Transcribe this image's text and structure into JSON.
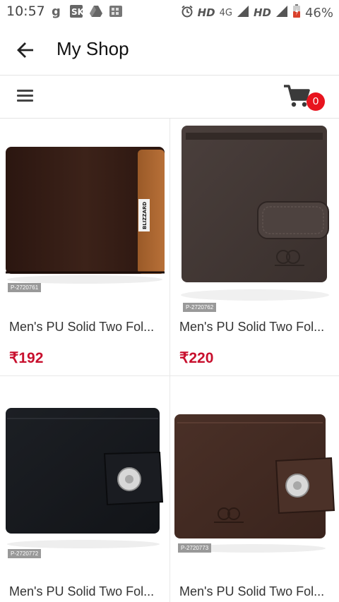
{
  "status": {
    "time": "10:57",
    "net_hd1": "HD",
    "net_4g": "4G",
    "net_hd2": "HD",
    "battery": "46%"
  },
  "header": {
    "title": "My Shop"
  },
  "cart": {
    "count": "0"
  },
  "products": [
    {
      "id": "P-2720761",
      "name": "Men's PU Solid Two Fol...",
      "price": "₹192",
      "brand_label": "BLIZZARD"
    },
    {
      "id": "P-2720762",
      "name": "Men's PU Solid Two Fol...",
      "price": "₹220"
    },
    {
      "id": "P-2720772",
      "name": "Men's PU Solid Two Fol..."
    },
    {
      "id": "P-2720773",
      "name": "Men's PU Solid Two Fol..."
    }
  ],
  "colors": {
    "accent": "#c8102e",
    "badge": "#e8141e"
  }
}
